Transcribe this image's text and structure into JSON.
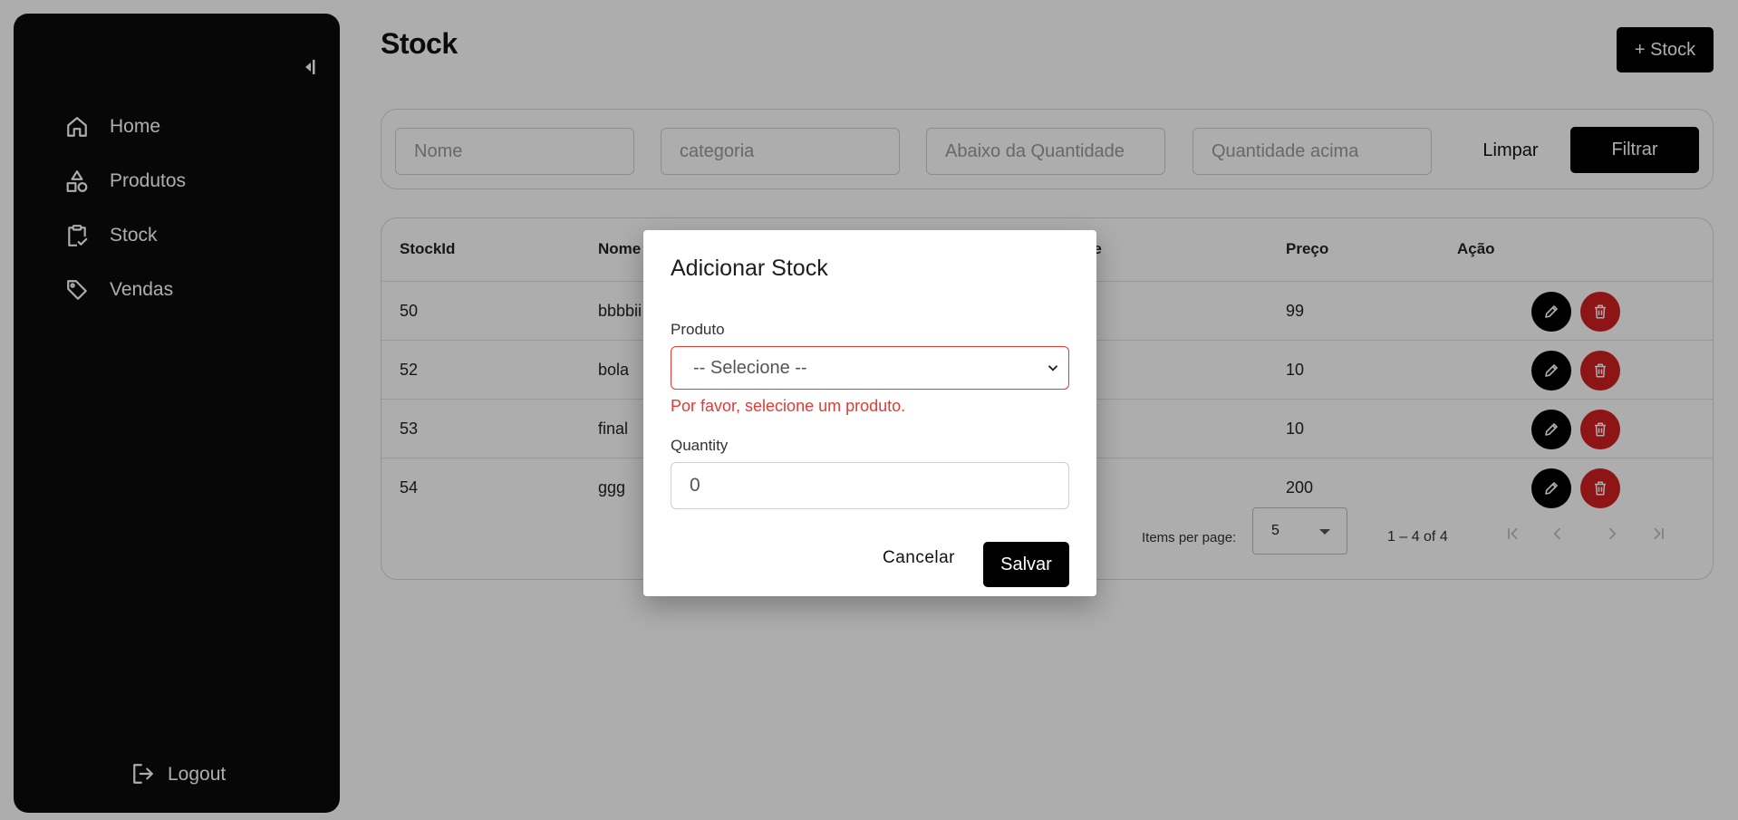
{
  "sidebar": {
    "collapse_icon": "collapse-left-icon",
    "items": [
      {
        "label": "Home",
        "icon": "home-icon"
      },
      {
        "label": "Produtos",
        "icon": "shapes-icon"
      },
      {
        "label": "Stock",
        "icon": "clipboard-check-icon"
      },
      {
        "label": "Vendas",
        "icon": "tag-icon"
      }
    ],
    "logout_label": "Logout"
  },
  "header": {
    "title": "Stock",
    "add_button_label": "+ Stock"
  },
  "filters": {
    "nome_placeholder": "Nome",
    "categoria_placeholder": "categoria",
    "abaixo_placeholder": "Abaixo da Quantidade",
    "acima_placeholder": "Quantidade acima",
    "limpar_label": "Limpar",
    "filtrar_label": "Filtrar"
  },
  "table": {
    "columns": [
      "StockId",
      "Nome",
      "de",
      "Preço",
      "Ação"
    ],
    "rows": [
      {
        "id": "50",
        "nome": "bbbbii",
        "preco": "99"
      },
      {
        "id": "52",
        "nome": "bola",
        "preco": "10"
      },
      {
        "id": "53",
        "nome": "final",
        "preco": "10"
      },
      {
        "id": "54",
        "nome": "ggg",
        "preco": "200"
      }
    ]
  },
  "paginator": {
    "items_per_page_label": "Items per page:",
    "page_size": "5",
    "range_label": "1 – 4 of 4"
  },
  "dialog": {
    "title": "Adicionar Stock",
    "produto_label": "Produto",
    "produto_value": "-- Selecione --",
    "produto_error": "Por favor, selecione um produto.",
    "quantity_label": "Quantity",
    "quantity_value": "0",
    "cancel_label": "Cancelar",
    "save_label": "Salvar"
  },
  "colors": {
    "sidebar_bg": "#0b0b0b",
    "primary_button": "#000000",
    "delete_button": "#d21f1f",
    "error": "#e53935"
  }
}
